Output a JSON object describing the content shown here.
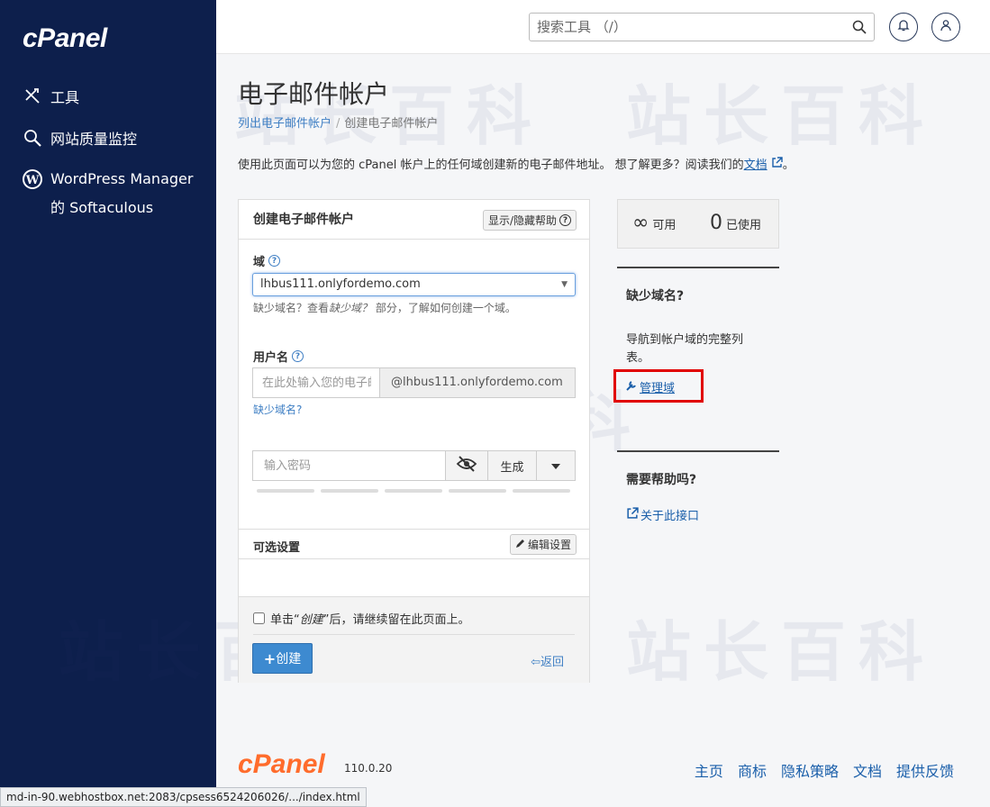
{
  "sidebar": {
    "logo": "cPanel",
    "items": [
      {
        "label": "工具",
        "icon": "tools-icon"
      },
      {
        "label": "网站质量监控",
        "icon": "magnifier-icon"
      },
      {
        "label": "WordPress Manager 的 Softaculous",
        "icon": "wordpress-icon"
      }
    ]
  },
  "header": {
    "search_placeholder": "搜索工具 （/）",
    "icons": [
      "search-icon",
      "bell-icon",
      "user-icon"
    ]
  },
  "watermark": "站长百科",
  "page": {
    "title": "电子邮件帐户",
    "breadcrumb": {
      "parent": "列出电子邮件帐户",
      "current": "创建电子邮件帐户"
    },
    "intro": "使用此页面可以为您的 cPanel 帐户上的任何域创建新的电子邮件地址。 想了解更多？阅读我们的",
    "intro_link": "文档",
    "intro_end": "。"
  },
  "form": {
    "title": "创建电子邮件帐户",
    "toggle_help": "显示/隐藏帮助",
    "domain_label": "域",
    "domain_value": "lhbus111.onlyfordemo.com",
    "domain_hint_1": "缺少域名？查看",
    "domain_hint_italic": "缺少域？",
    "domain_hint_2": "部分，了解如何创建一个域。",
    "username_label": "用户名",
    "username_placeholder": "在此处输入您的电子邮件",
    "username_addon": "@lhbus111.onlyfordemo.com",
    "missing_domain_link": "缺少域名?",
    "password_placeholder": "输入密码",
    "generate_label": "生成",
    "optional_title": "可选设置",
    "edit_settings": "编辑设置",
    "stay_1": "单击“",
    "stay_italic": "创建",
    "stay_2": "”后，请继续留在此页面上。",
    "create_label": "创建",
    "back_label": "返回"
  },
  "right": {
    "available_value": "∞",
    "available_label": "可用",
    "used_value": "0",
    "used_label": "已使用",
    "missing_title": "缺少域名?",
    "missing_text": "导航到帐户域的完整列表。",
    "manage_link": "管理域",
    "help_title": "需要帮助吗?",
    "about_link": "关于此接口"
  },
  "footer": {
    "logo": "cPanel",
    "version": "110.0.20",
    "links": [
      "主页",
      "商标",
      "隐私策略",
      "文档",
      "提供反馈"
    ]
  },
  "status_bar": "md-in-90.webhostbox.net:2083/cpsess6524206026/.../index.html",
  "colors": {
    "sidebar": "#0d1f4c",
    "accent": "#3d8ad0",
    "highlight": "#e10000",
    "brand_orange": "#ff6c2c"
  }
}
